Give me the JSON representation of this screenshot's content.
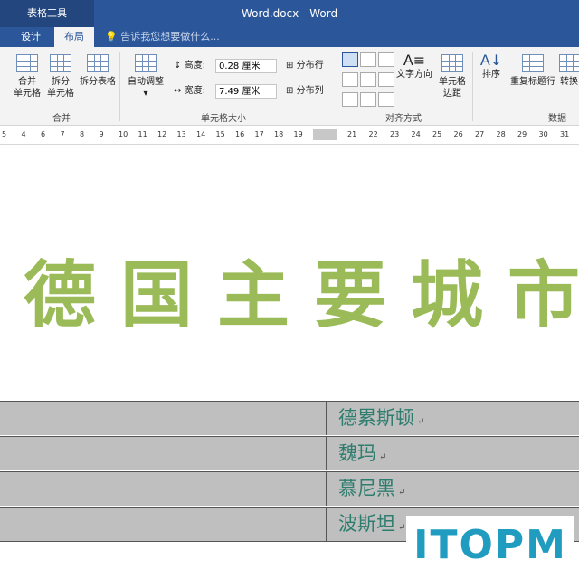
{
  "window": {
    "title": "Word.docx - Word",
    "context_tab": "表格工具"
  },
  "tabs": [
    {
      "label": "设计"
    },
    {
      "label": "布局"
    }
  ],
  "tell_me": "告诉我您想要做什么...",
  "ribbon": {
    "merge": {
      "merge_cells": "合并\n单元格",
      "split_cells": "拆分\n单元格",
      "split_table": "拆分表格",
      "group": "合并"
    },
    "cell_size": {
      "autofit": "自动调整",
      "height_label": "高度:",
      "height_value": "0.28 厘米",
      "width_label": "宽度:",
      "width_value": "7.49 厘米",
      "distribute_rows": "分布行",
      "distribute_cols": "分布列",
      "group": "单元格大小"
    },
    "alignment": {
      "text_direction": "文字方向",
      "cell_margins": "单元格\n边距",
      "group": "对齐方式"
    },
    "data": {
      "sort": "排序",
      "repeat_header": "重复标题行",
      "convert": "转换",
      "group": "数据"
    }
  },
  "ruler": {
    "left": [
      "5",
      "4",
      "6",
      "7",
      "8",
      "9",
      "10",
      "11",
      "12",
      "13",
      "14",
      "15",
      "16",
      "17",
      "18",
      "19"
    ],
    "right": [
      "21",
      "22",
      "23",
      "24",
      "25",
      "26",
      "27",
      "28",
      "29",
      "30",
      "31"
    ]
  },
  "document": {
    "heading": "德国主要城市",
    "table_rows": [
      {
        "text": "德累斯顿"
      },
      {
        "text": "魏玛"
      },
      {
        "text": "慕尼黑"
      },
      {
        "text": "波斯坦"
      }
    ],
    "paragraph_mark": "↵"
  },
  "watermark": "ITOPM",
  "colors": {
    "accent": "#2b579a",
    "heading": "#9bbb59",
    "cell_text": "#2e7d6e",
    "table_bg": "#bfbfbf",
    "logo": "#1f9cc0"
  }
}
